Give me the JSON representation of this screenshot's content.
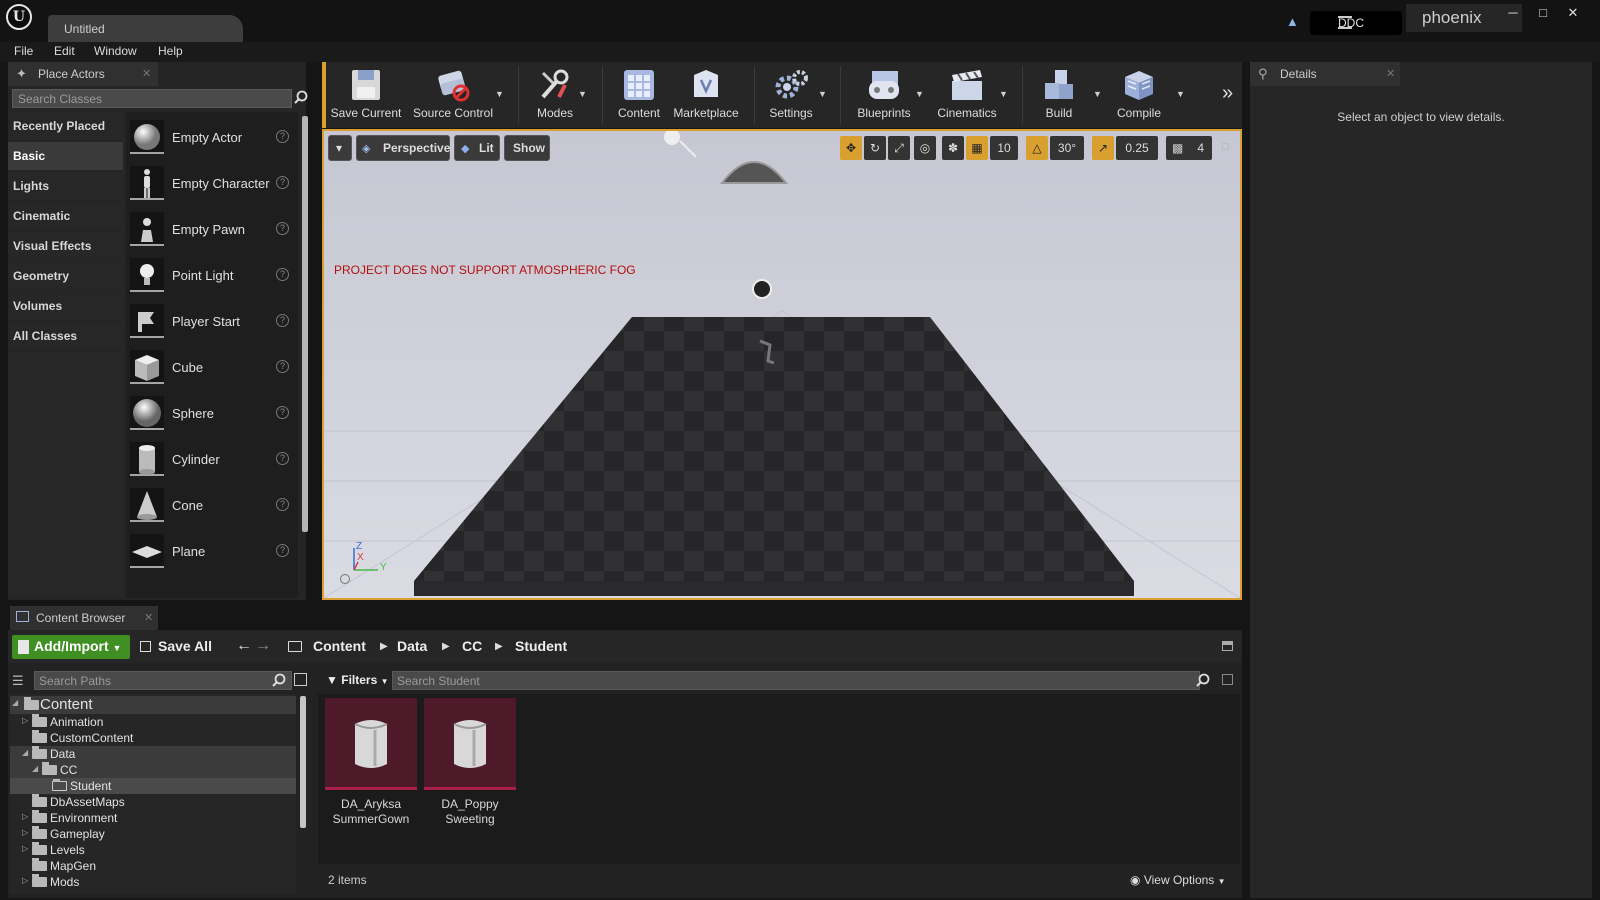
{
  "window": {
    "tab_title": "Untitled",
    "ddc_label": "DDC",
    "project_name": "phoenix",
    "logo": "U"
  },
  "menu": [
    "File",
    "Edit",
    "Window",
    "Help"
  ],
  "place_actors": {
    "tab_label": "Place Actors",
    "search_placeholder": "Search Classes",
    "categories": [
      "Recently Placed",
      "Basic",
      "Lights",
      "Cinematic",
      "Visual Effects",
      "Geometry",
      "Volumes",
      "All Classes"
    ],
    "selected_category": "Basic",
    "actors": [
      "Empty Actor",
      "Empty Character",
      "Empty Pawn",
      "Point Light",
      "Player Start",
      "Cube",
      "Sphere",
      "Cylinder",
      "Cone",
      "Plane"
    ]
  },
  "toolbar": {
    "buttons": [
      "Save Current",
      "Source Control",
      "Modes",
      "Content",
      "Marketplace",
      "Settings",
      "Blueprints",
      "Cinematics",
      "Build",
      "Compile"
    ]
  },
  "viewport": {
    "perspective_label": "Perspective",
    "lit_label": "Lit",
    "show_label": "Show",
    "grid_snap": "10",
    "rotation_snap": "30°",
    "scale_snap": "0.25",
    "camera_speed": "4",
    "warning": "PROJECT DOES NOT SUPPORT ATMOSPHERIC FOG",
    "axis_labels": [
      "Z",
      "X",
      "Y"
    ]
  },
  "details": {
    "tab_label": "Details",
    "empty_message": "Select an object to view details."
  },
  "content_browser": {
    "tab_label": "Content Browser",
    "add_import_label": "Add/Import",
    "save_all_label": "Save All",
    "breadcrumb": [
      "Content",
      "Data",
      "CC",
      "Student"
    ],
    "paths_placeholder": "Search Paths",
    "filters_label": "Filters",
    "asset_search_placeholder": "Search Student",
    "tree": [
      {
        "label": "Content",
        "level": 0
      },
      {
        "label": "Animation",
        "level": 1
      },
      {
        "label": "CustomContent",
        "level": 1
      },
      {
        "label": "Data",
        "level": 1
      },
      {
        "label": "CC",
        "level": 2
      },
      {
        "label": "Student",
        "level": 3
      },
      {
        "label": "DbAssetMaps",
        "level": 1
      },
      {
        "label": "Environment",
        "level": 1
      },
      {
        "label": "Gameplay",
        "level": 1
      },
      {
        "label": "Levels",
        "level": 1
      },
      {
        "label": "MapGen",
        "level": 1
      },
      {
        "label": "Mods",
        "level": 1
      }
    ],
    "assets": [
      {
        "line1": "DA_Aryksa",
        "line2": "SummerGown"
      },
      {
        "line1": "DA_Poppy",
        "line2": "Sweeting"
      }
    ],
    "item_count": "2 items",
    "view_options_label": "View Options"
  }
}
